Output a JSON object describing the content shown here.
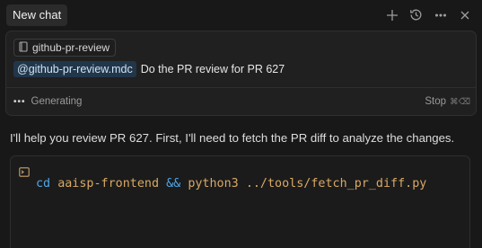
{
  "header": {
    "tab_label": "New chat",
    "icons": [
      "plus-icon",
      "history-icon",
      "more-icon",
      "close-icon"
    ]
  },
  "prompt": {
    "rule_chip": "github-pr-review",
    "mention": "@github-pr-review.mdc",
    "text": "Do the PR review for PR 627"
  },
  "status": {
    "dots": "•••",
    "label": "Generating",
    "stop_label": "Stop",
    "stop_shortcut": "⌘⌫"
  },
  "assistant": {
    "message": "I'll help you review PR 627. First, I'll need to fetch the PR diff to analyze the changes.",
    "code": {
      "cmd1": "cd",
      "arg1": "aaisp-frontend",
      "op": "&&",
      "cmd2": "python3",
      "path": "../tools/fetch_pr_diff.py"
    }
  },
  "colors": {
    "background": "#181818",
    "card": "#202020",
    "mention_bg": "#22364a",
    "command_blue": "#4fa6e8",
    "argument_orange": "#d9a864"
  }
}
